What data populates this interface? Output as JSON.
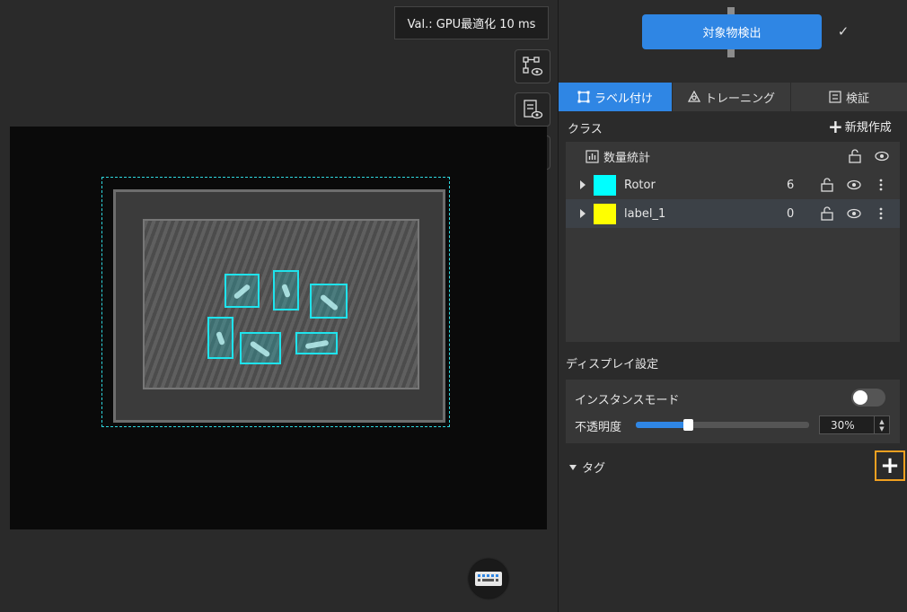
{
  "canvas": {
    "val_badge": "Val.: GPU最適化 10 ms",
    "tools": [
      {
        "icon": "tree-view-eye-icon"
      },
      {
        "icon": "checklist-eye-icon"
      },
      {
        "icon": "polygon-eye-icon"
      }
    ],
    "image": {
      "description": "crate-with-rotors"
    },
    "keyboard_icon": "keyboard-icon"
  },
  "pipeline": {
    "step_label": "対象物検出",
    "status_icon": "check-icon"
  },
  "tabs": [
    {
      "label": "ラベル付け",
      "icon": "label-icon",
      "active": true
    },
    {
      "label": "トレーニング",
      "icon": "training-icon",
      "active": false
    },
    {
      "label": "検証",
      "icon": "validate-icon",
      "active": false
    }
  ],
  "classes": {
    "title": "クラス",
    "new_label": "新規作成",
    "stats_label": "数量統計",
    "items": [
      {
        "name": "Rotor",
        "count": "6",
        "color": "#00ffff"
      },
      {
        "name": "label_1",
        "count": "0",
        "color": "#ffff00"
      }
    ]
  },
  "display": {
    "title": "ディスプレイ設定",
    "instance_mode_label": "インスタンスモード",
    "instance_mode_on": false,
    "opacity_label": "不透明度",
    "opacity_value": "30%",
    "opacity_fraction": 0.3
  },
  "tags": {
    "title": "タグ",
    "add_icon": "plus-icon"
  },
  "colors": {
    "accent": "#2f86e4",
    "highlight": "#f0a020"
  }
}
